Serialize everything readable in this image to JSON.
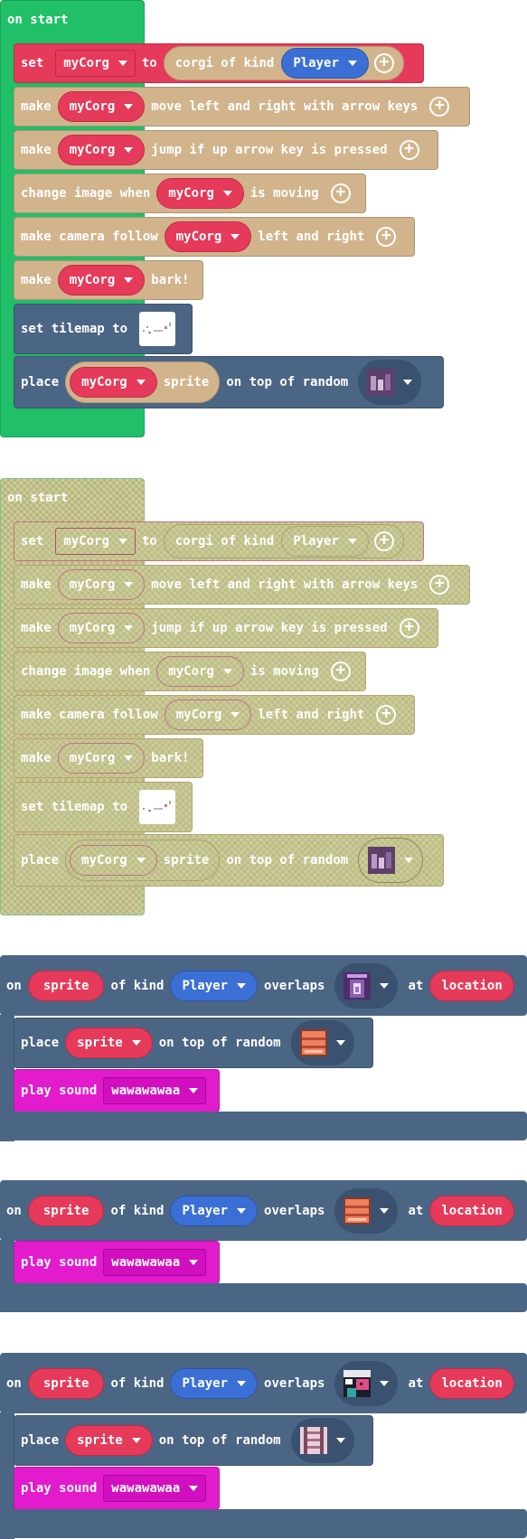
{
  "blocks": {
    "on_start": "on start",
    "set": "set",
    "to": "to",
    "make": "make",
    "corgi_of_kind": "corgi of kind",
    "move_text": "move left and right with arrow keys",
    "jump_text": "jump if up arrow key is pressed",
    "change_image_when": "change image when",
    "is_moving": "is moving",
    "make_camera_follow": "make camera follow",
    "left_and_right": "left and right",
    "bark": "bark!",
    "set_tilemap_to": "set tilemap to",
    "place": "place",
    "sprite_word": "sprite",
    "on_top_of_random": "on top of random",
    "on": "on",
    "of_kind": "of kind",
    "overlaps": "overlaps",
    "at": "at",
    "play_sound": "play sound"
  },
  "values": {
    "var_mycorg": "myCorg",
    "kind_player": "Player",
    "sprite": "sprite",
    "location": "location",
    "sound": "wawawawaa"
  },
  "colors": {
    "hat_green": "#20bf68",
    "corgi_tan": "#d2b48c",
    "variable_red": "#e63a5a",
    "scene_slate": "#4b6584",
    "kind_blue": "#3b6fd6",
    "music_magenta": "#e21bcd"
  },
  "icons": {
    "dropdown": "triangle-down",
    "add": "plus-circle",
    "tilemap": "tilemap-thumbnail",
    "tile_purple": "purple-tile-image",
    "tile_door": "door-tile-image",
    "tile_crate": "crate-tile-image",
    "tile_ladder": "ladder-tile-image",
    "tile_face": "face-tile-image"
  }
}
